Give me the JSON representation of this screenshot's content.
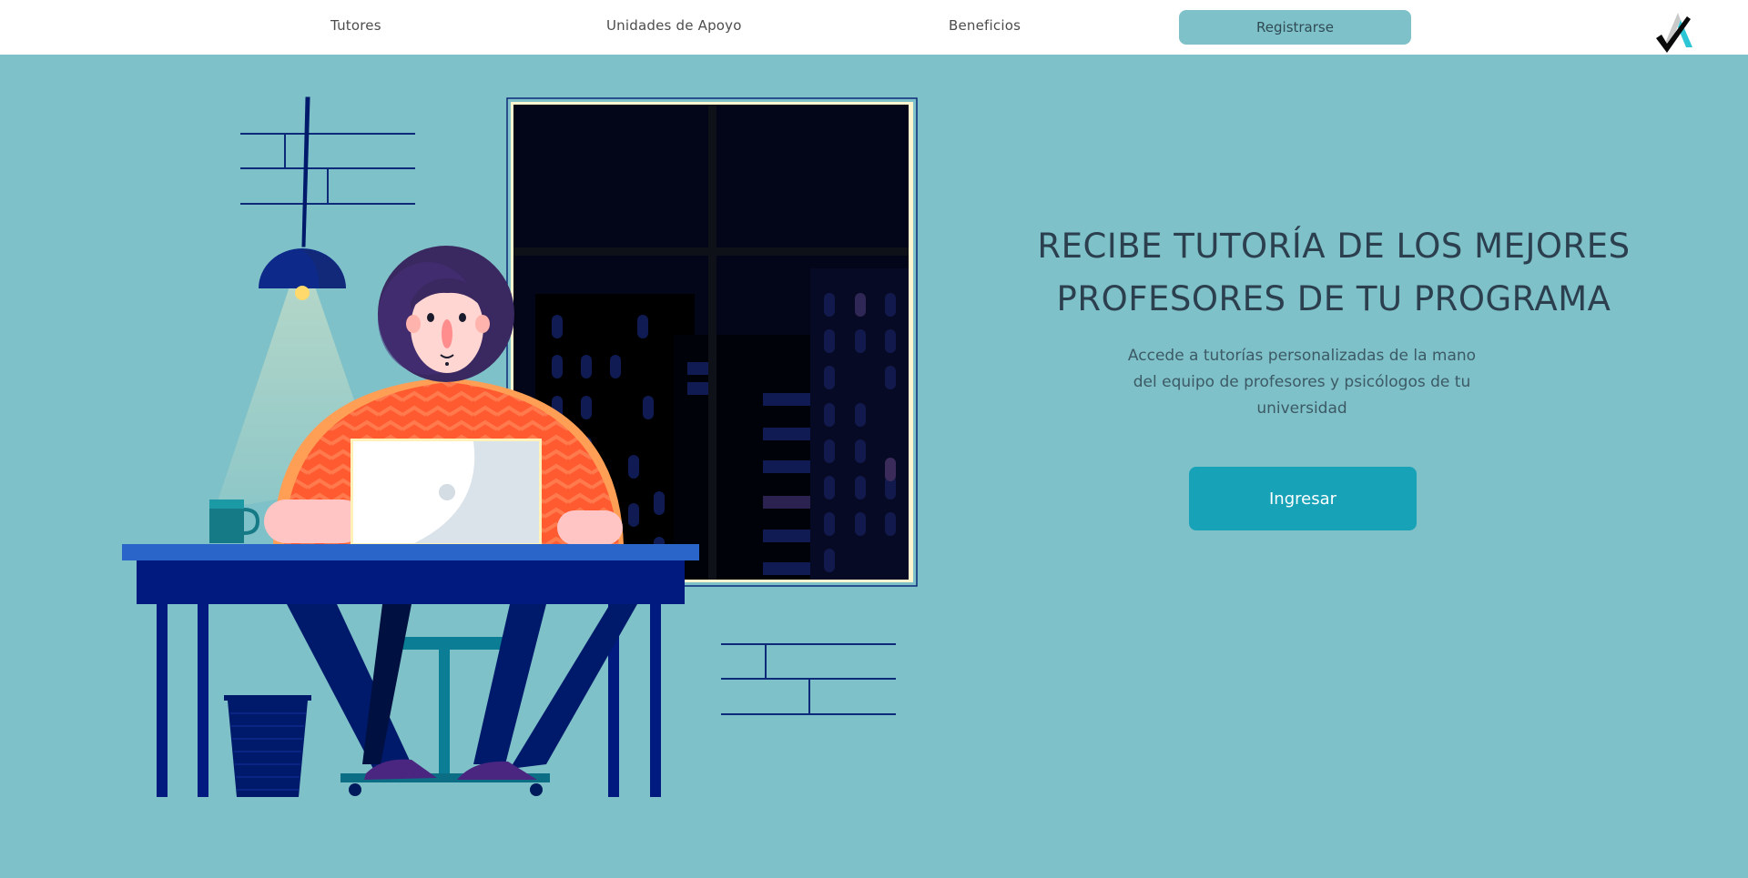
{
  "nav": {
    "items": [
      {
        "label": "Tutores"
      },
      {
        "label": "Unidades de Apoyo"
      },
      {
        "label": "Beneficios"
      }
    ],
    "register_label": "Registrarse"
  },
  "logo": {
    "icon": "check-logo-icon"
  },
  "hero": {
    "title_line1": "RECIBE TUTORÍA DE LOS MEJORES",
    "title_line2": "PROFESORES DE TU PROGRAMA",
    "description": "Accede a tutorías personalizadas de la mano del equipo de profesores y psicólogos de tu universidad",
    "cta_label": "Ingresar"
  },
  "colors": {
    "background": "#7fc1c8",
    "header": "#ffffff",
    "register_button": "#7fc1c8",
    "cta_button": "#17a2b8",
    "title_text": "#2b3f4f"
  }
}
